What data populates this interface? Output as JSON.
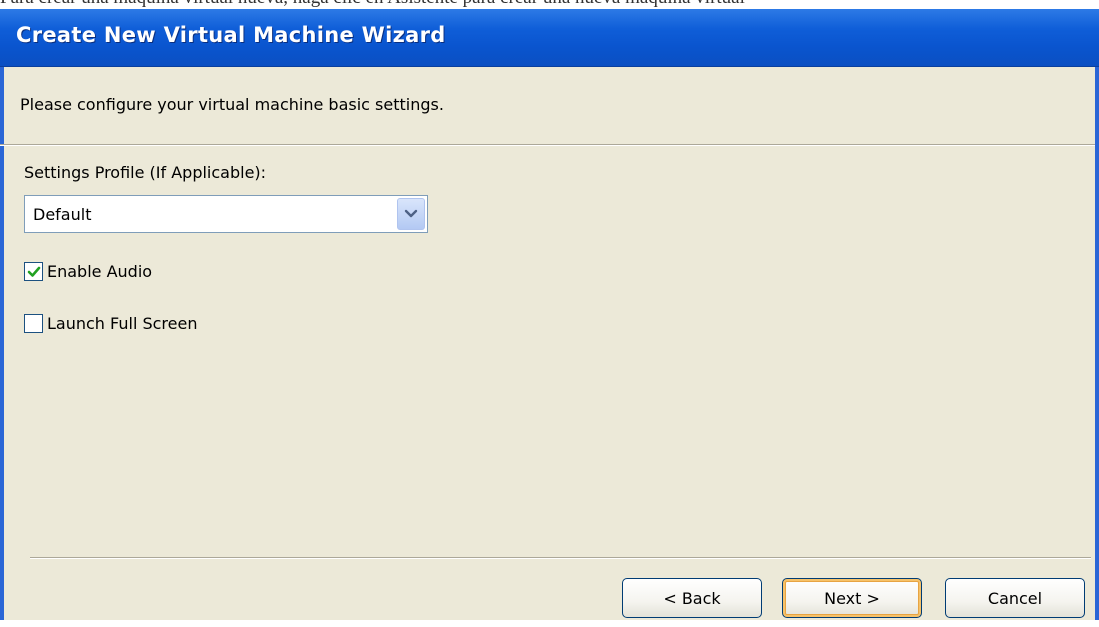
{
  "window": {
    "title": "Create New Virtual Machine Wizard"
  },
  "top_strip_text": "Para crear una máquina virtual nueva, haga clic en Asistente para crear una nueva máquina virtual",
  "page": {
    "subtitle": "Please configure your virtual machine basic settings."
  },
  "settings_profile": {
    "label": "Settings Profile (If Applicable):",
    "selected": "Default"
  },
  "options": {
    "enable_audio": {
      "label": "Enable Audio",
      "checked": true
    },
    "launch_full_screen": {
      "label": "Launch Full Screen",
      "checked": false
    }
  },
  "buttons": {
    "back": "< Back",
    "next": "Next >",
    "cancel": "Cancel"
  }
}
